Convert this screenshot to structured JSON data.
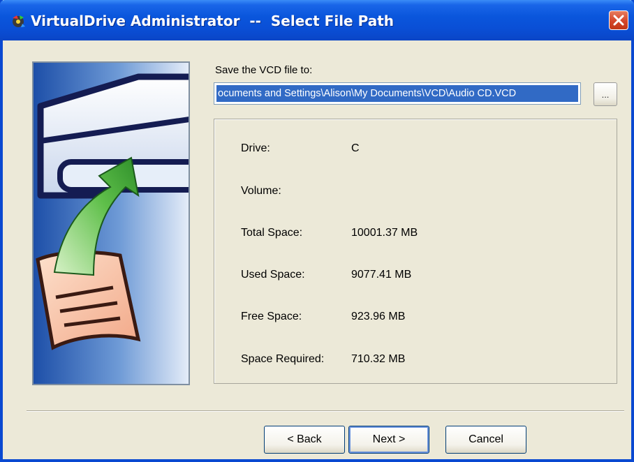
{
  "window": {
    "title": "VirtualDrive Administrator  --  Select File Path",
    "app_icon": "virtualdrive-app-icon",
    "close_icon": "close-icon"
  },
  "form": {
    "path_label": "Save the VCD file to:",
    "path_value": "ocuments and Settings\\Alison\\My Documents\\VCD\\Audio CD.VCD",
    "browse_label": "..."
  },
  "info": {
    "drive_label": "Drive:",
    "drive_value": "C",
    "volume_label": "Volume:",
    "volume_value": "",
    "total_label": "Total Space:",
    "total_value": "10001.37 MB",
    "used_label": "Used Space:",
    "used_value": "9077.41 MB",
    "free_label": "Free Space:",
    "free_value": "923.96 MB",
    "required_label": "Space Required:",
    "required_value": "710.32 MB"
  },
  "buttons": {
    "back": "< Back",
    "next": "Next >",
    "cancel": "Cancel"
  }
}
